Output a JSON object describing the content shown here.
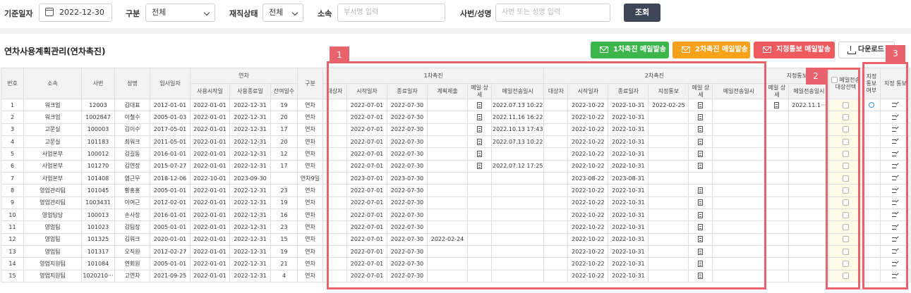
{
  "filters": {
    "date_label": "기준일자",
    "date_value": "2022-12-30",
    "type_label": "구분",
    "type_value": "전체",
    "status_label": "재직상태",
    "status_value": "전체",
    "dept_label": "소속",
    "dept_placeholder": "부서명 입력",
    "emp_label": "사번/성명",
    "emp_placeholder": "사번 또는 성명 입력",
    "search_label": "조회"
  },
  "section_title": "연차사용계획관리(연차촉진)",
  "actions": {
    "first_mail": "1차촉진 메일발송",
    "second_mail": "2차촉진 메일발송",
    "designate_mail": "지정통보 메일발송",
    "download": "다운로드"
  },
  "colors": {
    "green": "#3cb64a",
    "orange": "#f8a21b",
    "red": "#ef5a5f",
    "annotation": "#e8636b",
    "dark_btn": "#3c4656"
  },
  "headers": {
    "no": "번호",
    "dept": "소속",
    "emp_id": "사번",
    "name": "성명",
    "hire": "입사일자",
    "annual": "연차",
    "use_start": "사용시작일",
    "use_end": "사용종료일",
    "remain": "잔여일수",
    "kind": "구분",
    "first": "1차촉진",
    "f_target": "대상자",
    "f_start": "시작일자",
    "f_end": "종료일자",
    "f_plan": "계획제출",
    "f_mail_detail": "메일 상세",
    "f_mail_sent": "메일전송일시",
    "second": "2차촉진",
    "s_target": "대상자",
    "s_start": "시작일자",
    "s_end": "종료일자",
    "s_notice": "지정통보",
    "s_mail_detail": "메일 상세",
    "s_mail_sent": "메일전송일시",
    "designate": "지정통보",
    "d_mail_detail": "메일 상세",
    "d_mail_sent": "메일전송일시",
    "mail_select": "메일전송 대상선택",
    "notice_flag": "지정 통보 여부",
    "notice": "지정 통보"
  },
  "rows": [
    {
      "no": "1",
      "dept": "워크업",
      "emp_id": "12003",
      "name": "김대표",
      "hire": "2012-01-01",
      "use_start": "2022-01-01",
      "use_end": "2022-12-31",
      "remain": "19",
      "kind": "연차",
      "f_start": "2022-07-01",
      "f_end": "2022-07-30",
      "f_plan": "",
      "f_doc": true,
      "f_sent": "2022.07.13 10:22",
      "s_start": "2022-10-22",
      "s_end": "2022-10-31",
      "s_notice": "2022-02-25",
      "s_doc": true,
      "s_sent": "",
      "d_doc": true,
      "d_sent": "2022.11.1···",
      "flag": true
    },
    {
      "no": "2",
      "dept": "워크업",
      "emp_id": "1002847",
      "name": "이철수",
      "hire": "2005-01-03",
      "use_start": "2022-01-01",
      "use_end": "2022-12-31",
      "remain": "20",
      "kind": "연차",
      "f_start": "2022-07-01",
      "f_end": "2022-07-30",
      "f_plan": "",
      "f_doc": true,
      "f_sent": "2022.11.16 16:22",
      "s_start": "2022-10-22",
      "s_end": "2022-10-31",
      "s_notice": "",
      "s_doc": true,
      "s_sent": "",
      "d_doc": false,
      "d_sent": "",
      "flag": false
    },
    {
      "no": "3",
      "dept": "고문실",
      "emp_id": "100003",
      "name": "김이수",
      "hire": "2017-05-01",
      "use_start": "2022-01-01",
      "use_end": "2022-12-31",
      "remain": "17",
      "kind": "연차",
      "f_start": "2022-07-01",
      "f_end": "2022-07-30",
      "f_plan": "",
      "f_doc": true,
      "f_sent": "2022.10.13 17:43",
      "s_start": "2022-10-22",
      "s_end": "2022-10-31",
      "s_notice": "",
      "s_doc": true,
      "s_sent": "",
      "d_doc": false,
      "d_sent": "",
      "flag": false
    },
    {
      "no": "4",
      "dept": "고문실",
      "emp_id": "101183",
      "name": "최워크",
      "hire": "2011-05-01",
      "use_start": "2022-01-01",
      "use_end": "2022-12-31",
      "remain": "20",
      "kind": "연차",
      "f_start": "2022-07-01",
      "f_end": "2022-07-30",
      "f_plan": "",
      "f_doc": true,
      "f_sent": "2022.07.13 10:22",
      "s_start": "2022-10-22",
      "s_end": "2022-10-31",
      "s_notice": "",
      "s_doc": true,
      "s_sent": "",
      "d_doc": false,
      "d_sent": "",
      "flag": false
    },
    {
      "no": "5",
      "dept": "사업본부",
      "emp_id": "100012",
      "name": "김길동",
      "hire": "2016-01-01",
      "use_start": "2022-01-01",
      "use_end": "2022-12-31",
      "remain": "12",
      "kind": "연차",
      "f_start": "2022-07-01",
      "f_end": "2022-07-30",
      "f_plan": "",
      "f_doc": true,
      "f_sent": "",
      "s_start": "2022-10-22",
      "s_end": "2022-10-31",
      "s_notice": "",
      "s_doc": true,
      "s_sent": "",
      "d_doc": false,
      "d_sent": "",
      "flag": false
    },
    {
      "no": "6",
      "dept": "사업본부",
      "emp_id": "101270",
      "name": "김연장",
      "hire": "2015-07-27",
      "use_start": "2022-01-01",
      "use_end": "2022-12-31",
      "remain": "17",
      "kind": "연차",
      "f_start": "2022-07-01",
      "f_end": "2022-07-30",
      "f_plan": "",
      "f_doc": true,
      "f_sent": "2022.07.12 17:25",
      "s_start": "2022-10-22",
      "s_end": "2022-10-31",
      "s_notice": "",
      "s_doc": true,
      "s_sent": "",
      "d_doc": false,
      "d_sent": "",
      "flag": false
    },
    {
      "no": "7",
      "dept": "사업본부",
      "emp_id": "101408",
      "name": "염근무",
      "hire": "2018-12-06",
      "use_start": "2022-10-01",
      "use_end": "2023-09-30",
      "remain": "",
      "kind": "연차9일",
      "f_start": "2023-07-01",
      "f_end": "2023-07-30",
      "f_plan": "",
      "f_doc": false,
      "f_sent": "",
      "s_start": "2023-08-22",
      "s_end": "2023-08-31",
      "s_notice": "",
      "s_doc": false,
      "s_sent": "",
      "d_doc": false,
      "d_sent": "",
      "flag": false
    },
    {
      "no": "8",
      "dept": "영업관리팀",
      "emp_id": "101045",
      "name": "황홍홍",
      "hire": "2005-01-01",
      "use_start": "2022-01-01",
      "use_end": "2022-12-31",
      "remain": "23",
      "kind": "연차",
      "f_start": "2022-07-01",
      "f_end": "2022-07-30",
      "f_plan": "",
      "f_doc": false,
      "f_sent": "",
      "s_start": "2022-10-22",
      "s_end": "2022-10-31",
      "s_notice": "",
      "s_doc": true,
      "s_sent": "",
      "d_doc": false,
      "d_sent": "",
      "flag": false
    },
    {
      "no": "9",
      "dept": "영업관리팀",
      "emp_id": "1003431",
      "name": "이여근",
      "hire": "2012-02-01",
      "use_start": "2022-01-01",
      "use_end": "2022-12-31",
      "remain": "19",
      "kind": "연차",
      "f_start": "2022-07-01",
      "f_end": "2022-07-30",
      "f_plan": "",
      "f_doc": false,
      "f_sent": "",
      "s_start": "2022-10-22",
      "s_end": "2022-10-31",
      "s_notice": "",
      "s_doc": true,
      "s_sent": "",
      "d_doc": false,
      "d_sent": "",
      "flag": false
    },
    {
      "no": "10",
      "dept": "영업담당",
      "emp_id": "100013",
      "name": "손사장",
      "hire": "2016-01-01",
      "use_start": "2022-01-01",
      "use_end": "2022-12-31",
      "remain": "16",
      "kind": "연차",
      "f_start": "2022-07-01",
      "f_end": "2022-07-30",
      "f_plan": "",
      "f_doc": false,
      "f_sent": "",
      "s_start": "2022-10-22",
      "s_end": "2022-10-31",
      "s_notice": "",
      "s_doc": true,
      "s_sent": "",
      "d_doc": false,
      "d_sent": "",
      "flag": false
    },
    {
      "no": "11",
      "dept": "영업팀",
      "emp_id": "101023",
      "name": "김팀장",
      "hire": "2005-01-01",
      "use_start": "2022-01-01",
      "use_end": "2022-12-31",
      "remain": "23",
      "kind": "연차",
      "f_start": "2022-07-01",
      "f_end": "2022-07-30",
      "f_plan": "",
      "f_doc": false,
      "f_sent": "",
      "s_start": "2022-10-22",
      "s_end": "2022-10-31",
      "s_notice": "",
      "s_doc": true,
      "s_sent": "",
      "d_doc": false,
      "d_sent": "",
      "flag": false
    },
    {
      "no": "12",
      "dept": "영업팀",
      "emp_id": "101325",
      "name": "김워크",
      "hire": "2020-01-01",
      "use_start": "2022-01-01",
      "use_end": "2022-12-31",
      "remain": "15",
      "kind": "연차",
      "f_start": "2022-07-01",
      "f_end": "2022-07-30",
      "f_plan": "2022-02-24",
      "f_doc": false,
      "f_sent": "",
      "s_start": "2022-10-22",
      "s_end": "2022-10-31",
      "s_notice": "",
      "s_doc": true,
      "s_sent": "",
      "d_doc": false,
      "d_sent": "",
      "flag": false
    },
    {
      "no": "13",
      "dept": "영업팀",
      "emp_id": "101317",
      "name": "오직원",
      "hire": "2012-02-27",
      "use_start": "2022-01-01",
      "use_end": "2022-12-31",
      "remain": "19",
      "kind": "연차",
      "f_start": "2022-07-01",
      "f_end": "2022-07-30",
      "f_plan": "",
      "f_doc": false,
      "f_sent": "",
      "s_start": "2022-10-22",
      "s_end": "2022-10-31",
      "s_notice": "",
      "s_doc": true,
      "s_sent": "",
      "d_doc": false,
      "d_sent": "",
      "flag": false
    },
    {
      "no": "14",
      "dept": "영업지원팀",
      "emp_id": "101084",
      "name": "연회원",
      "hire": "2005-01-01",
      "use_start": "2022-01-01",
      "use_end": "2022-12-31",
      "remain": "21",
      "kind": "연차",
      "f_start": "2022-07-01",
      "f_end": "2022-07-30",
      "f_plan": "",
      "f_doc": false,
      "f_sent": "",
      "s_start": "2022-10-22",
      "s_end": "2022-10-31",
      "s_notice": "",
      "s_doc": true,
      "s_sent": "",
      "d_doc": false,
      "d_sent": "",
      "flag": false
    },
    {
      "no": "15",
      "dept": "영업지원팀",
      "emp_id": "1020210···",
      "name": "고연차",
      "hire": "2021-09-25",
      "use_start": "2022-01-01",
      "use_end": "2022-12-31",
      "remain": "4",
      "kind": "연차",
      "f_start": "2022-07-01",
      "f_end": "2022-07-30",
      "f_plan": "",
      "f_doc": false,
      "f_sent": "",
      "s_start": "2022-10-22",
      "s_end": "2022-10-31",
      "s_notice": "",
      "s_doc": true,
      "s_sent": "",
      "d_doc": false,
      "d_sent": "",
      "flag": false
    }
  ],
  "annotations": [
    "1",
    "2",
    "3"
  ]
}
